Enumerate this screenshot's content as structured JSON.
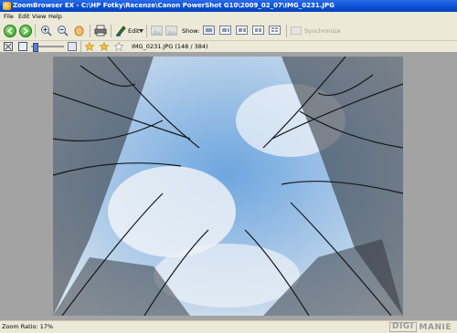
{
  "window": {
    "title": "ZoomBrowser EX - C:\\HP Fotky\\Recenze\\Canon PowerShot G10\\2009_02_07\\IMG_0231.JPG"
  },
  "menu": [
    "File",
    "Edit",
    "View",
    "Help"
  ],
  "toolbar": {
    "edit_label": "Edit",
    "show_label": "Show:",
    "synchronize_label": "Synchronize"
  },
  "toolbar2": {
    "file_info": "IMG_0231.JPG (148 / 384)"
  },
  "status": {
    "zoom": "Zoom Ratio: 17%"
  },
  "watermark": {
    "left": "DIGI",
    "right": "MANIE"
  }
}
